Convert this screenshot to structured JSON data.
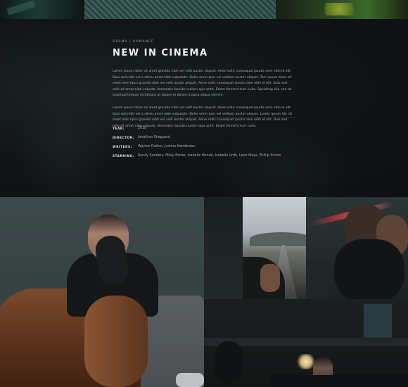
{
  "hero": {
    "genre": "DRAMA / ROMANCE",
    "title": "NEW IN CINEMA",
    "paragraph1": "Lorem ipsum dolor sit amet gravida nibh vel velit auctor aliquet. Aene sollic consequat ipsutis sem nibh id elit. Duis sed nibh vel a sitreu amet nibh vulputate. Dolor orem Ipsn vel velitum auctor aliquet. Tem ipsum dolor sit amet nem lipsn gravida nibh vel velit auctor aliquet. Aene sollic consequat ipsutis sem nibh id elit. Duis sed odio sit amet nibh vulputa. Venenatis faucibs nullom quis ante. Etiam ferment tum nulla. Opcidimg elit, sed do eiusmod tempor incididunt ut labore et dolore magna aliqua utenim.",
    "paragraph2": "Lorem ipsum dolor sit amet gravida nibh vel velit auctor aliquet. Aene sollic consequat ipsutis sem nibh id elit. Duis sed nibh vel a sitreu amet nibh vulputate. Dolor orem Ipsn vel velitum auctor aliquet. Lorem ipsum iibr sit amet nem lipsn gravida nibh vel velit auctor aliquet. Aene sollic consequat ipsutis sem nibh id elit. Duis sed odio sit amet nibh vulputa. Venenatis faucibs nullom quis ante. Etiam ferment tum nulla."
  },
  "credits": [
    {
      "key": "YEAR:",
      "value": "2018"
    },
    {
      "key": "DIRECTOR:",
      "value": "Jonathan Sheppard"
    },
    {
      "key": "WRITERS:",
      "value": "Waylon Dalton, Justine Henderson"
    },
    {
      "key": "STARRING:",
      "value": "Randy Sanders, Miley Porter, Isabelle Mcnde, Isabelle Urdo, Leon Mays, Phillip Simon"
    }
  ]
}
